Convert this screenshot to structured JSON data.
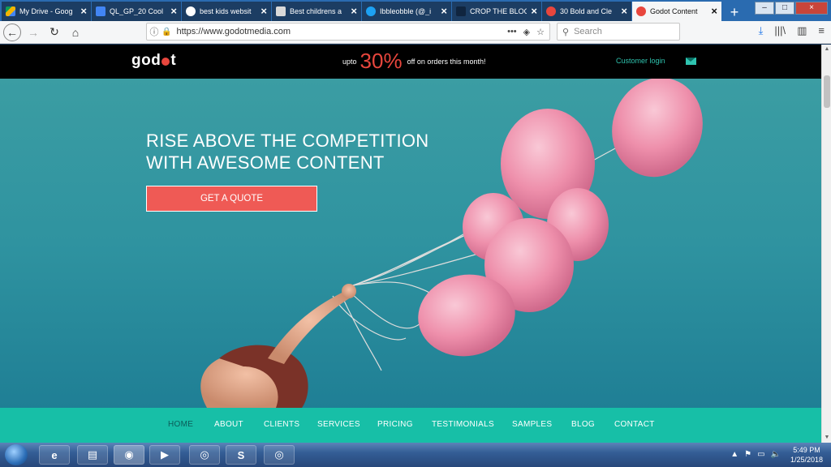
{
  "browser": {
    "tabs": [
      {
        "title": "My Drive - Goog",
        "favicon_color": "#f4b400",
        "icon": "drive-icon"
      },
      {
        "title": "QL_GP_20 Cool",
        "favicon_color": "#4285f4",
        "icon": "docs-icon"
      },
      {
        "title": "best kids websit",
        "favicon_color": "#ffffff",
        "icon": "google-icon"
      },
      {
        "title": "Best childrens a",
        "favicon_color": "#ffffff",
        "icon": "site-icon"
      },
      {
        "title": "Ibbleobble (@_i",
        "favicon_color": "#1da1f2",
        "icon": "twitter-icon"
      },
      {
        "title": "CROP THE BLOC",
        "favicon_color": "#1c3d63",
        "icon": "crop-icon"
      },
      {
        "title": "30 Bold and Cle",
        "favicon_color": "#e8463d",
        "icon": "site-icon"
      },
      {
        "title": "Godot Content",
        "favicon_color": "#e8463d",
        "icon": "godot-icon"
      }
    ],
    "active_tab": 7,
    "new_tab_label": "+",
    "url": "https://www.godotmedia.com",
    "search_placeholder": "Search",
    "page_actions": "•••"
  },
  "site": {
    "logo_left": "god",
    "logo_right": "t",
    "promo": {
      "prefix": "upto",
      "highlight": "30%",
      "suffix": "off on orders this month!"
    },
    "login_label": "Customer login",
    "headline_line1": "RISE ABOVE THE COMPETITION",
    "headline_line2": "WITH AWESOME CONTENT",
    "cta_label": "GET A QUOTE",
    "nav": [
      "HOME",
      "ABOUT",
      "CLIENTS",
      "SERVICES",
      "PRICING",
      "TESTIMONIALS",
      "SAMPLES",
      "BLOG",
      "CONTACT"
    ],
    "active_nav": "HOME",
    "colors": {
      "accent": "#e8463d",
      "teal": "#17bfa7",
      "hero": "#2f93a0"
    }
  },
  "taskbar": {
    "apps": [
      "internet-explorer-icon",
      "file-explorer-icon",
      "firefox-icon",
      "media-player-icon",
      "chrome-icon",
      "skype-icon",
      "chrome-app-icon"
    ],
    "time": "5:49 PM",
    "date": "1/25/2018"
  }
}
